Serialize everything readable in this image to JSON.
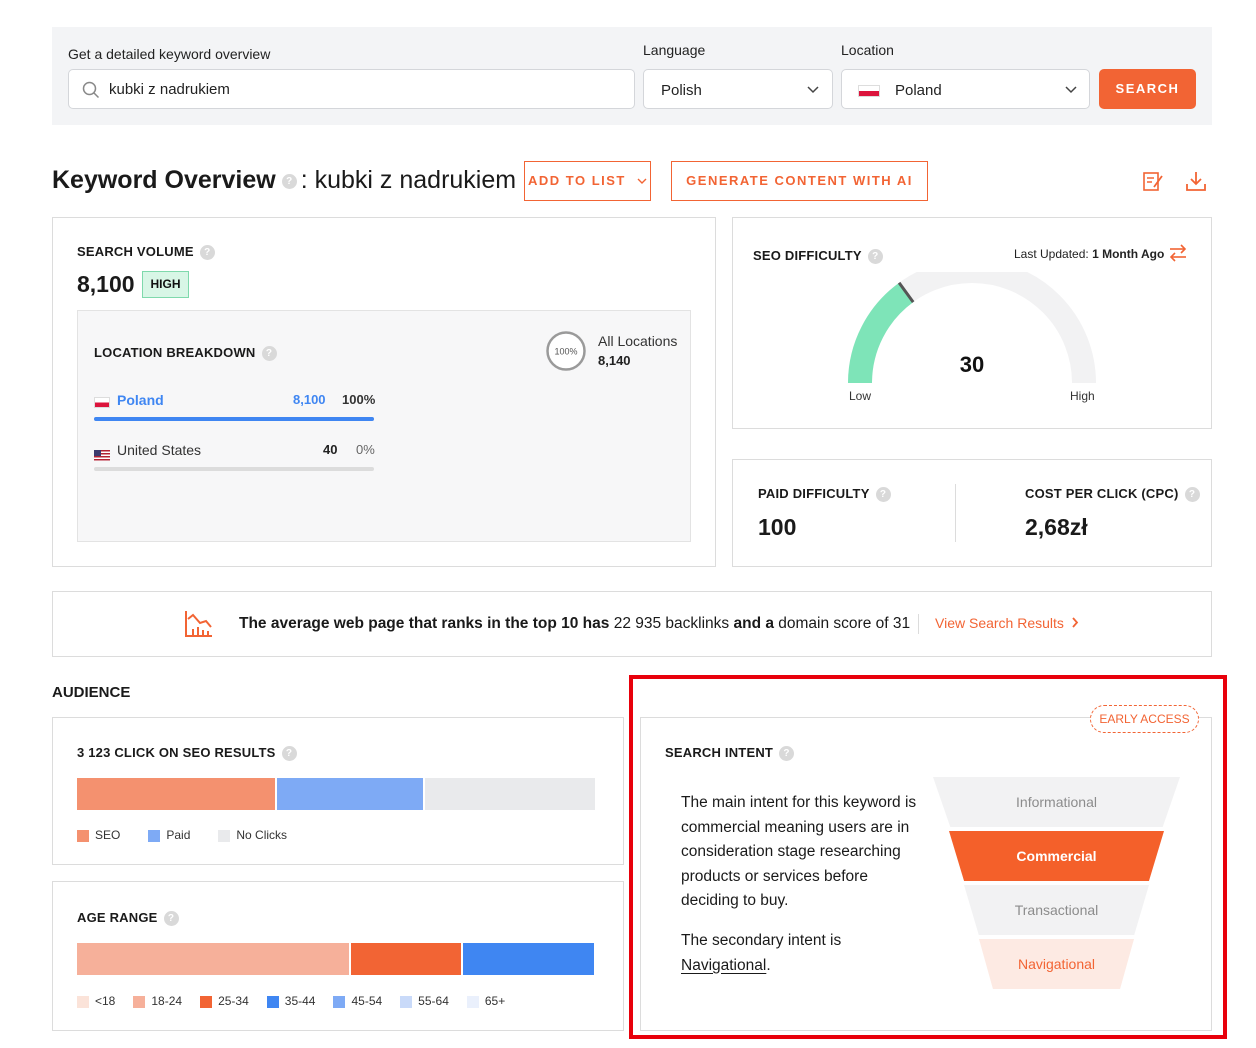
{
  "search_bar": {
    "keyword_label": "Get a detailed keyword overview",
    "keyword_value": "kubki z nadrukiem",
    "language_label": "Language",
    "language_value": "Polish",
    "location_label": "Location",
    "location_value": "Poland",
    "search_button": "SEARCH"
  },
  "header": {
    "title": "Keyword Overview",
    "keyword": ": kubki z nadrukiem",
    "add_to_list": "ADD TO LIST",
    "generate": "GENERATE CONTENT WITH AI"
  },
  "search_volume": {
    "label": "SEARCH VOLUME",
    "value": "8,100",
    "badge": "HIGH",
    "breakdown_label": "LOCATION BREAKDOWN",
    "ring_value": "100%",
    "all_locations_label": "All Locations",
    "all_locations_value": "8,140",
    "rows": [
      {
        "country": "Poland",
        "volume": "8,100",
        "share": "100%",
        "fill": 1.0
      },
      {
        "country": "United States",
        "volume": "40",
        "share": "0%",
        "fill": 0.0
      }
    ]
  },
  "seo_difficulty": {
    "label": "SEO DIFFICULTY",
    "updated_prefix": "Last Updated:",
    "updated_value": "1 Month Ago",
    "value": "30",
    "gauge_fraction": 0.3,
    "low": "Low",
    "high": "High",
    "colors": {
      "fill": "#7ee4b8",
      "track": "#f2f2f3"
    }
  },
  "paid": {
    "paid_label": "PAID DIFFICULTY",
    "paid_value": "100",
    "cpc_label": "COST PER CLICK (CPC)",
    "cpc_value": "2,68zł"
  },
  "backlinks": {
    "p1": "The average web page that ranks in the top 10 has",
    "n1": "22 935 backlinks",
    "p2": "and a",
    "n2": "domain score of 31",
    "link": "View Search Results"
  },
  "audience": {
    "title": "AUDIENCE",
    "clicks_label": "3 123 CLICK ON SEO RESULTS",
    "clicks_segments": [
      {
        "name": "SEO",
        "share": 0.385,
        "color": "#f4916f"
      },
      {
        "name": "Paid",
        "share": 0.285,
        "color": "#7eaaf5"
      },
      {
        "name": "No Clicks",
        "share": 0.33,
        "color": "#e9eaec"
      }
    ],
    "age_label": "AGE RANGE",
    "age_segments": [
      {
        "name": "<18",
        "share": 0.0,
        "color": "#fbe3d9"
      },
      {
        "name": "18-24",
        "share": 0.528,
        "color": "#f6b09a"
      },
      {
        "name": "25-34",
        "share": 0.215,
        "color": "#f26434"
      },
      {
        "name": "35-44",
        "share": 0.257,
        "color": "#3f86f2"
      },
      {
        "name": "45-54",
        "share": 0.0,
        "color": "#7eaaf5"
      },
      {
        "name": "55-64",
        "share": 0.0,
        "color": "#c9daf9"
      },
      {
        "name": "65+",
        "share": 0.0,
        "color": "#eaf0fc"
      }
    ]
  },
  "intent": {
    "badge": "EARLY ACCESS",
    "label": "SEARCH INTENT",
    "description": "The main intent for this keyword is commercial meaning users are in consideration stage researching products or services before deciding to buy.",
    "secondary_prefix": "The secondary intent is",
    "secondary_value": "Navigational",
    "secondary_suffix": ".",
    "levels": [
      "Informational",
      "Commercial",
      "Transactional",
      "Navigational"
    ]
  },
  "colors": {
    "accent": "#f26434",
    "blue": "#3f86f2",
    "highlight": "#e8000b"
  }
}
